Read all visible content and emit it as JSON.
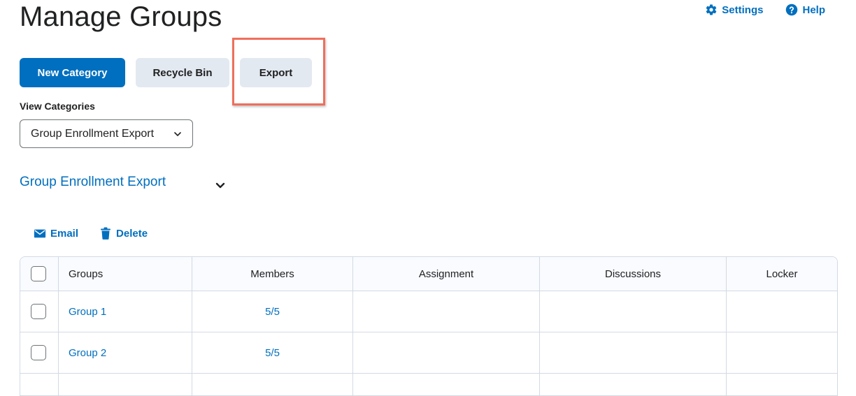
{
  "page": {
    "title": "Manage Groups"
  },
  "top_links": {
    "settings": "Settings",
    "help": "Help"
  },
  "toolbar": {
    "new_category": "New Category",
    "recycle_bin": "Recycle Bin",
    "export": "Export"
  },
  "view_categories": {
    "label": "View Categories",
    "selected": "Group Enrollment Export"
  },
  "category": {
    "title": "Group Enrollment Export"
  },
  "actions": {
    "email": "Email",
    "delete": "Delete"
  },
  "table": {
    "headers": [
      "Groups",
      "Members",
      "Assignment",
      "Discussions",
      "Locker"
    ],
    "rows": [
      {
        "group": "Group 1",
        "members": "5/5",
        "assignment": "",
        "discussions": "",
        "locker": ""
      },
      {
        "group": "Group 2",
        "members": "5/5",
        "assignment": "",
        "discussions": "",
        "locker": ""
      }
    ]
  },
  "colors": {
    "accent": "#006fbf",
    "secondary_button": "#e3e9f1",
    "highlight": "#ef6f5c"
  },
  "icons": {
    "settings": "gear-icon",
    "help": "question-circle-icon",
    "select": "chevron-down-icon",
    "email": "envelope-icon",
    "delete": "trash-icon"
  }
}
